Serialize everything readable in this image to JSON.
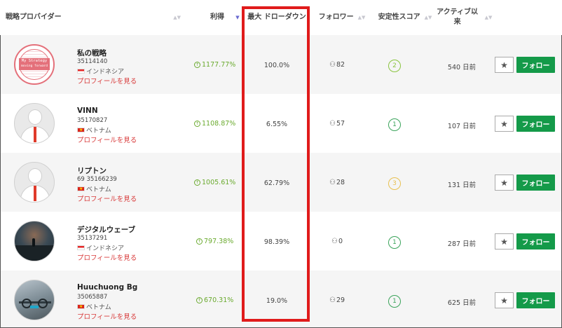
{
  "header": {
    "provider": "戦略プロバイダー",
    "profit": "利得",
    "max_drawdown": "最大 ドローダウン",
    "followers": "フォロワー",
    "stability": "安定性スコア",
    "active_ago": "アクティブ以来"
  },
  "follow_label": "フォロー",
  "profile_label": "プロフィールを見る",
  "providers": [
    {
      "name": "私の戦略",
      "account": "35114140",
      "country": "インドネシア",
      "flag": "id",
      "profit": "1177.77%",
      "drawdown": "100.0%",
      "followers": "82",
      "score": "2",
      "score_color": "lime",
      "active": "540 日前",
      "avatar_text_1": "My Strategy",
      "avatar_text_2": "moving forward"
    },
    {
      "name": "VINN",
      "account": "35170827",
      "country": "ベトナム",
      "flag": "vn",
      "profit": "1108.87%",
      "drawdown": "6.55%",
      "followers": "57",
      "score": "1",
      "score_color": "green",
      "active": "107 日前"
    },
    {
      "name": "リプトン",
      "account": "69 35166239",
      "country": "ベトナム",
      "flag": "vn",
      "profit": "1005.61%",
      "drawdown": "62.79%",
      "followers": "28",
      "score": "3",
      "score_color": "amber",
      "active": "131 日前"
    },
    {
      "name": "デジタルウェーブ",
      "account": "35137291",
      "country": "インドネシア",
      "flag": "id",
      "profit": "797.38%",
      "drawdown": "98.39%",
      "followers": "0",
      "score": "1",
      "score_color": "green",
      "active": "287 日前"
    },
    {
      "name": "Huuchuong Bg",
      "account": "35065887",
      "country": "ベトナム",
      "flag": "vn",
      "profit": "670.31%",
      "drawdown": "19.0%",
      "followers": "29",
      "score": "1",
      "score_color": "green",
      "active": "625 日前"
    }
  ],
  "colors": {
    "follow_button": "#149a49",
    "highlight": "#e01b1b",
    "profile_link": "#d83a3a",
    "profit": "#6aaa2e"
  }
}
